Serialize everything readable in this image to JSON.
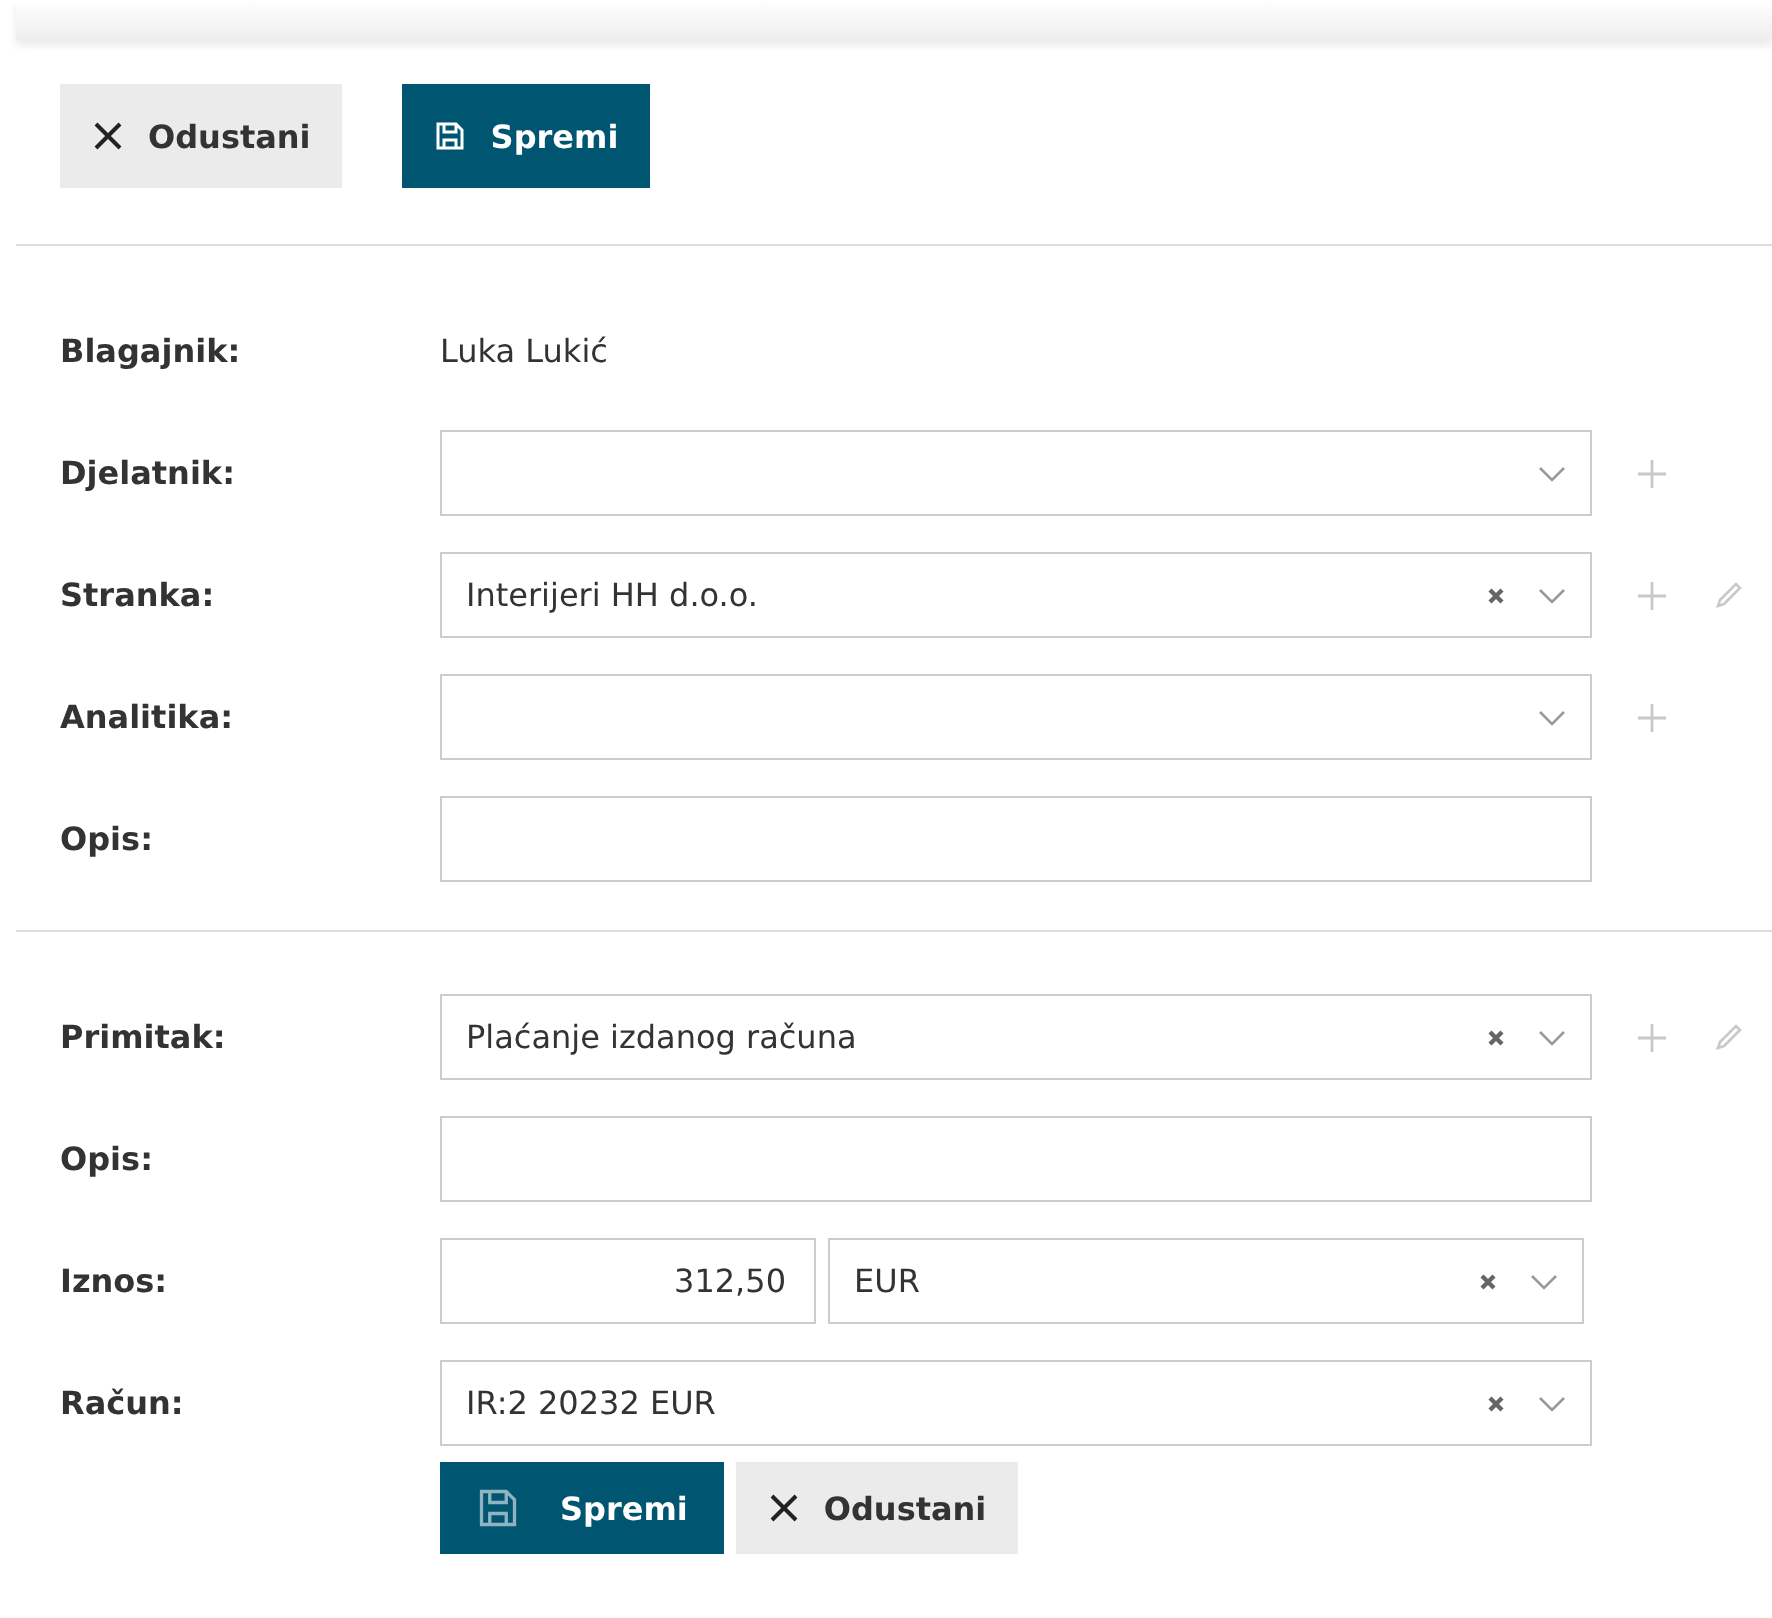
{
  "toolbar": {
    "buttons": [
      {
        "kind": "cancel",
        "label": "Odustani"
      },
      {
        "kind": "save",
        "label": "Spremi"
      }
    ]
  },
  "sections": [
    {
      "fields": [
        {
          "kind": "text",
          "label": "Blagajnik:",
          "value": "Luka Lukić"
        },
        {
          "kind": "select",
          "label": "Djelatnik:",
          "clearable": false,
          "actions": [
            {
              "kind": "add"
            }
          ]
        },
        {
          "kind": "select",
          "label": "Stranka:",
          "value": "Interijeri HH d.o.o.",
          "clearable": true,
          "actions": [
            {
              "kind": "add"
            },
            {
              "kind": "edit"
            }
          ]
        },
        {
          "kind": "select",
          "label": "Analitika:",
          "clearable": false,
          "actions": [
            {
              "kind": "add"
            }
          ]
        },
        {
          "kind": "input",
          "label": "Opis:"
        }
      ]
    },
    {
      "fields": [
        {
          "kind": "select",
          "label": "Primitak:",
          "value": "Plaćanje izdanog računa",
          "clearable": true,
          "actions": [
            {
              "kind": "add"
            },
            {
              "kind": "edit"
            }
          ]
        },
        {
          "kind": "input",
          "label": "Opis:"
        },
        {
          "kind": "amount",
          "label": "Iznos:",
          "value": "312,50",
          "currency": "EUR",
          "clearable": true
        },
        {
          "kind": "select",
          "label": "Račun:",
          "value": "IR:2 20232 EUR",
          "clearable": true
        }
      ]
    }
  ],
  "footer": {
    "buttons": [
      {
        "kind": "save",
        "label": "Spremi"
      },
      {
        "kind": "cancel",
        "label": "Odustani"
      }
    ]
  }
}
